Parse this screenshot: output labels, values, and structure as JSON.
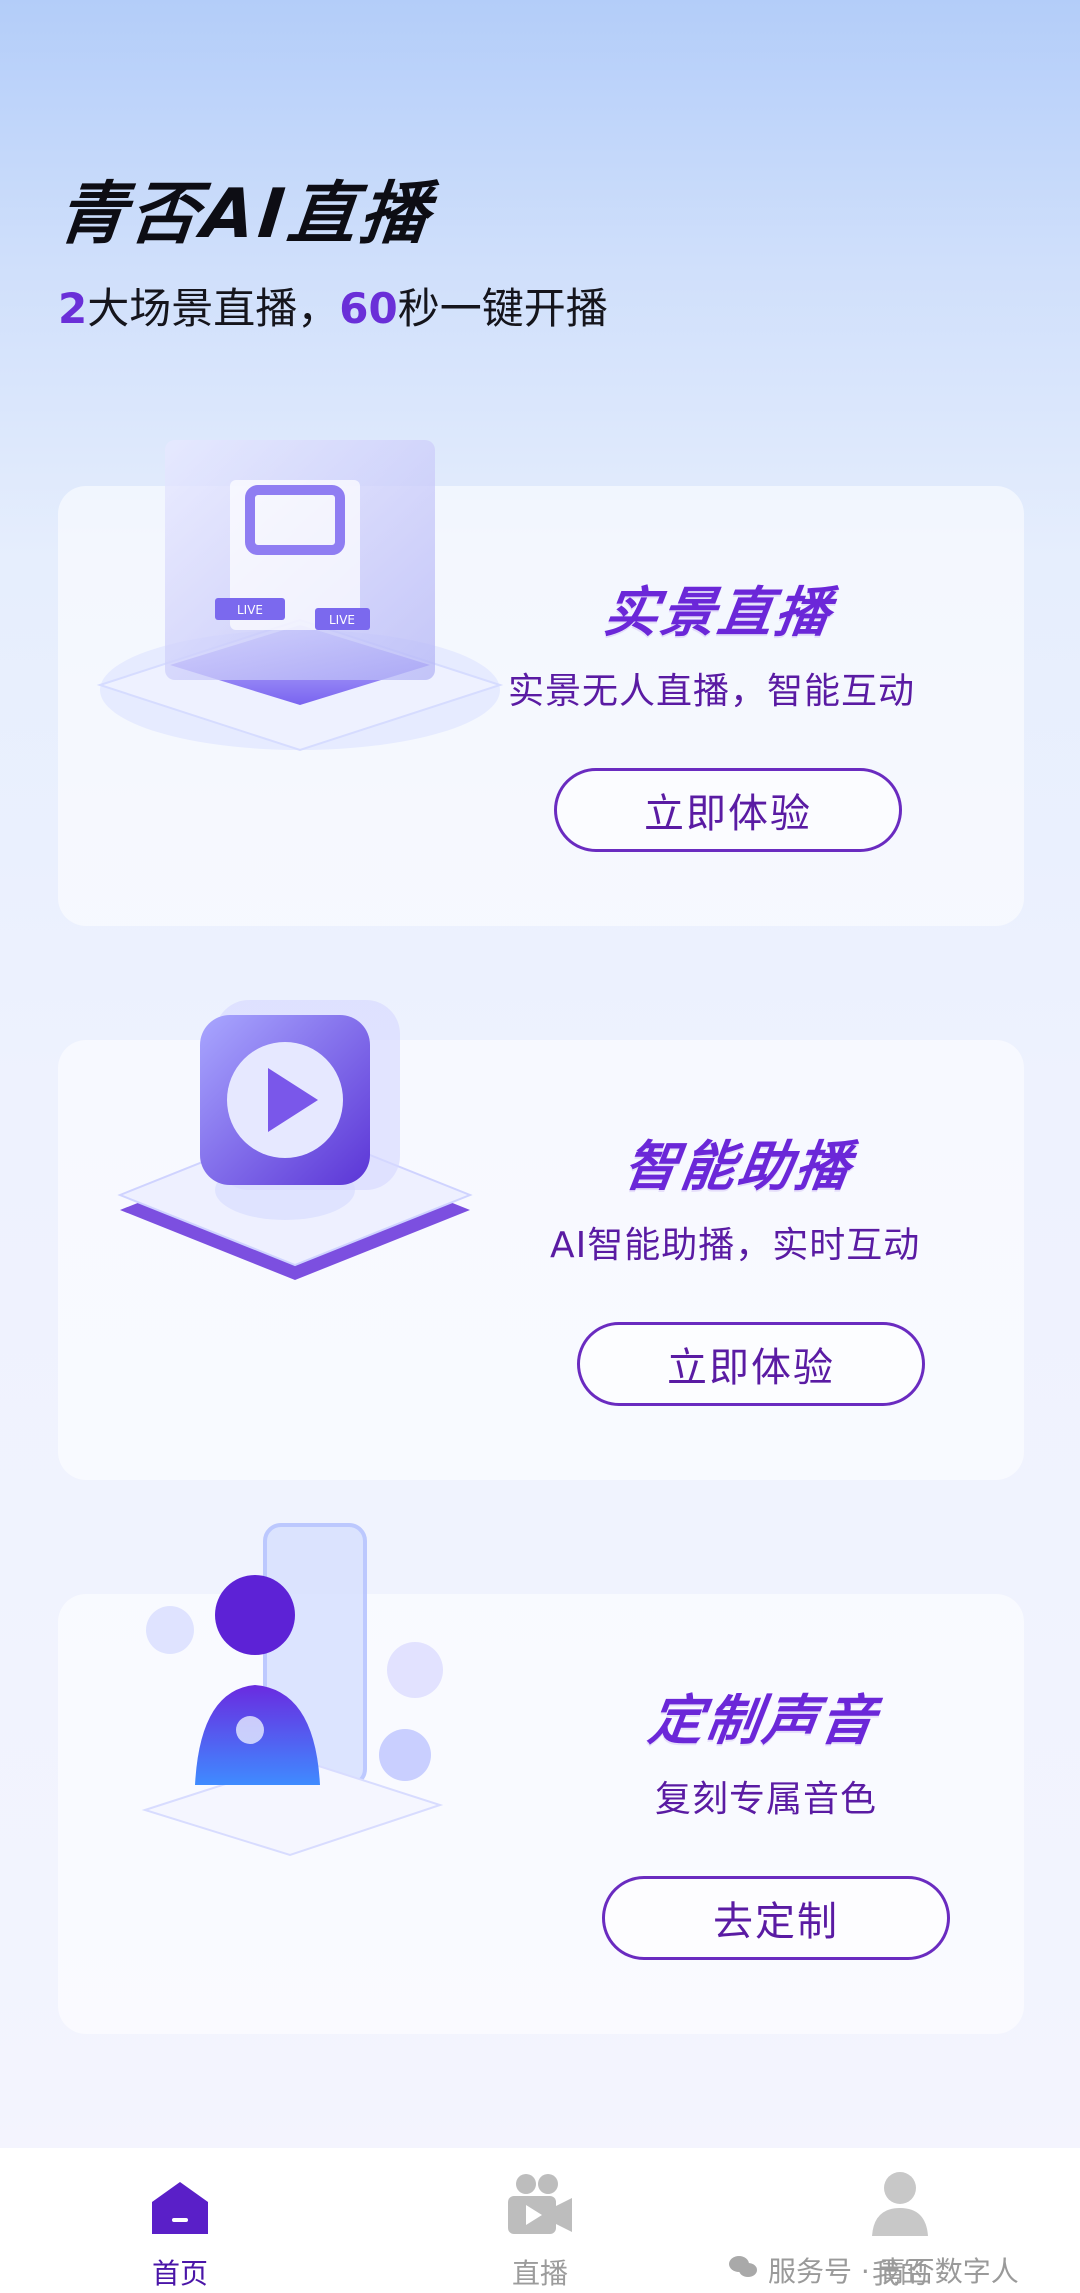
{
  "header": {
    "app_title": "青否AI直播",
    "subtitle": {
      "n1": "2",
      "t1": "大场景直播，",
      "n2": "60",
      "t2": "秒一键开播"
    }
  },
  "cards": [
    {
      "title": "实景直播",
      "desc": "实景无人直播，智能互动",
      "button": "立即体验",
      "icon": "live-cube-icon"
    },
    {
      "title": "智能助播",
      "desc": "AI智能助播，实时互动",
      "button": "立即体验",
      "icon": "play-camera-icon"
    },
    {
      "title": "定制声音",
      "desc": "复刻专属音色",
      "button": "去定制",
      "icon": "digital-human-icon"
    }
  ],
  "tabs": [
    {
      "label": "首页",
      "icon": "home-icon",
      "active": true
    },
    {
      "label": "直播",
      "icon": "video-camera-icon",
      "active": false
    },
    {
      "label": "我的",
      "icon": "user-icon",
      "active": false
    }
  ],
  "watermark": {
    "text": "服务号 · 青否数字人",
    "icon": "wechat-icon"
  },
  "colors": {
    "accent": "#6b27d8",
    "button_border": "#6a2bc0",
    "active_tab": "#4a15a8"
  }
}
